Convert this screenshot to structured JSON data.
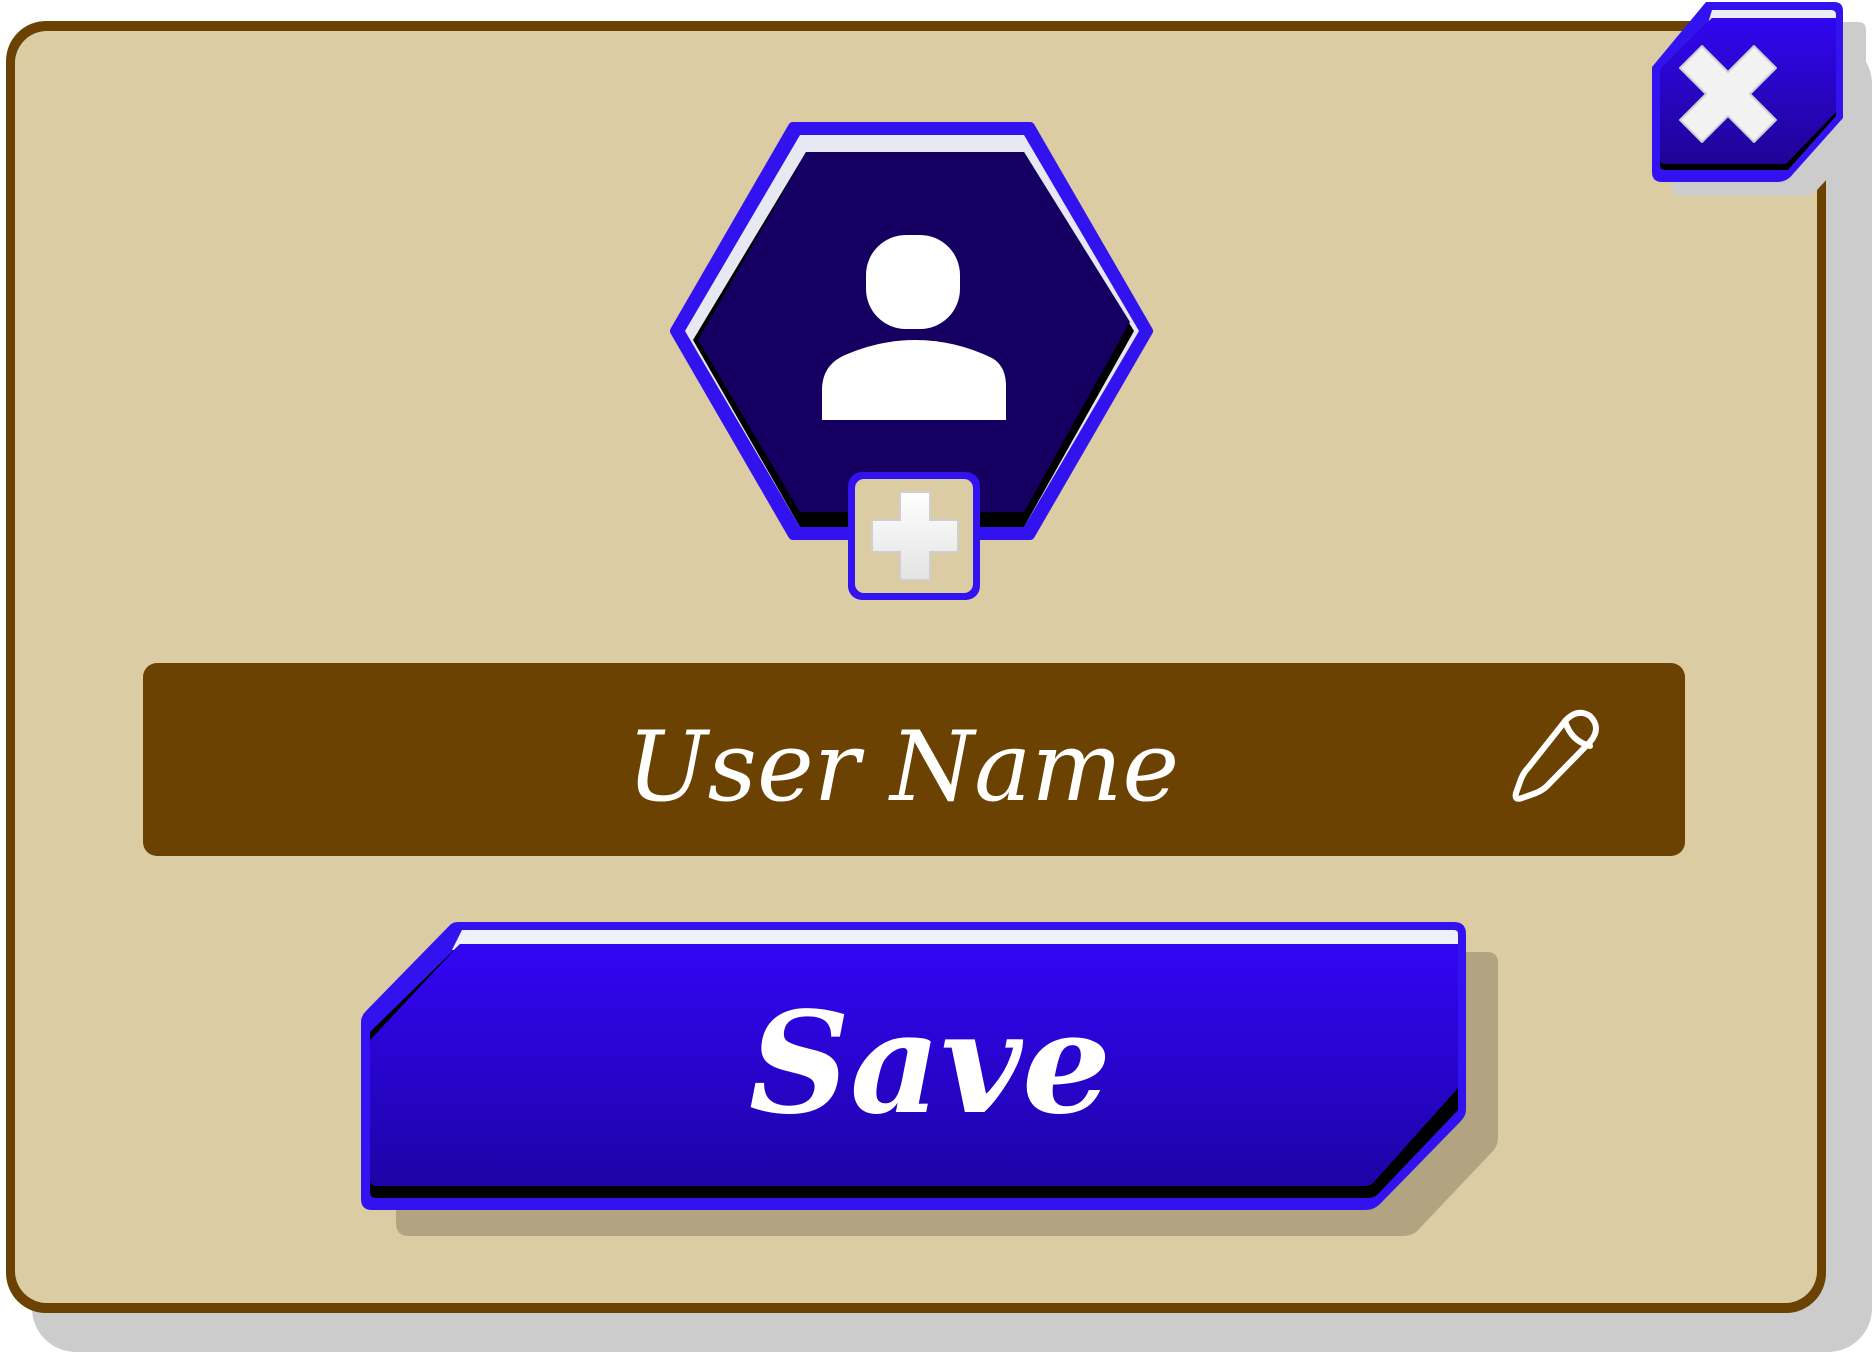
{
  "dialog": {
    "avatar": {
      "icon": "user-icon",
      "add_button_icon": "plus-icon"
    },
    "close_button": {
      "icon": "close-x-icon"
    },
    "name_field": {
      "value": "User Name",
      "edit_icon": "pencil-icon"
    },
    "save_button": {
      "label": "Save"
    }
  },
  "colors": {
    "panel_fill": "#dbcca3",
    "panel_border": "#6b4201",
    "button_blue": "#2e05f2",
    "button_blue_dark": "#21048c",
    "avatar_fill": "#150061",
    "accent_border": "#3312f0",
    "field_fill": "#6b4201",
    "shadow": "#cccccc"
  }
}
